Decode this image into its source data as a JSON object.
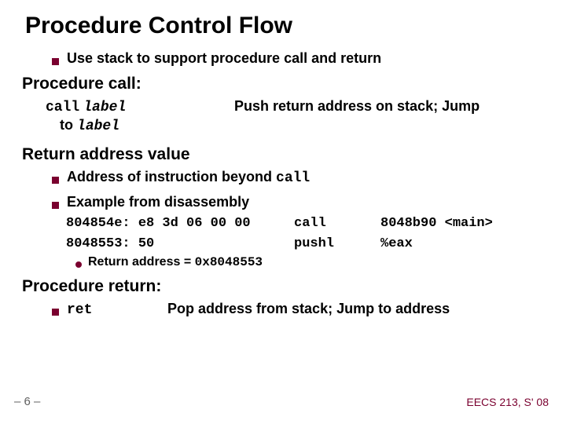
{
  "title": "Procedure Control Flow",
  "b1": "Use stack to support procedure call and return",
  "sec1": "Procedure call:",
  "call_kw": "call",
  "label_kw": "label",
  "to_kw": "to",
  "call_desc": "Push return address on stack; Jump",
  "sec2": "Return address value",
  "b2a_pre": "Address of instruction beyond ",
  "b2a_code": "call",
  "b2b": "Example from disassembly",
  "dis": [
    {
      "c1": "804854e: e8 3d 06 00 00",
      "c2": "call",
      "c3": "8048b90 <main>"
    },
    {
      "c1": "8048553: 50",
      "c2": "pushl",
      "c3": "%eax"
    }
  ],
  "ra_pre": "Return address = ",
  "ra_val": "0x8048553",
  "sec3": "Procedure return:",
  "ret_kw": "ret",
  "ret_desc": "Pop address from stack; Jump to address",
  "page": "– 6 –",
  "course": "EECS 213, S' 08"
}
